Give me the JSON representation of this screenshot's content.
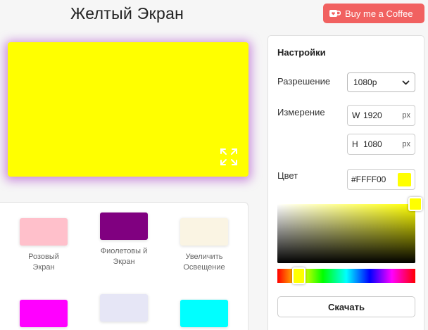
{
  "header": {
    "title": "Желтый Экран",
    "coffee_label": "Buy me a Coffee",
    "coffee_color": "#f16160"
  },
  "preview": {
    "color": "#FFFF00",
    "fullscreen_icon": "fullscreen-expand-icon"
  },
  "swatches": [
    {
      "label": "Розовый Экран",
      "color": "#ffc0cb"
    },
    {
      "label": "Фиолетовы й Экран",
      "color": "#800080"
    },
    {
      "label": "Увеличить Освещение",
      "color": "#faf4e3"
    },
    {
      "label": "",
      "color": "#ff00ff"
    },
    {
      "label": "",
      "color": "#e6e6f6"
    },
    {
      "label": "",
      "color": "#00ffff"
    }
  ],
  "settings": {
    "title": "Настройки",
    "resolution_label": "Разрешение",
    "resolution_value": "1080p",
    "dimension_label": "Измерение",
    "width_axis": "W",
    "width_value": "1920",
    "height_axis": "H",
    "height_value": "1080",
    "unit": "px",
    "color_label": "Цвет",
    "hex_value": "#FFFF00",
    "download_label": "Скачать"
  }
}
